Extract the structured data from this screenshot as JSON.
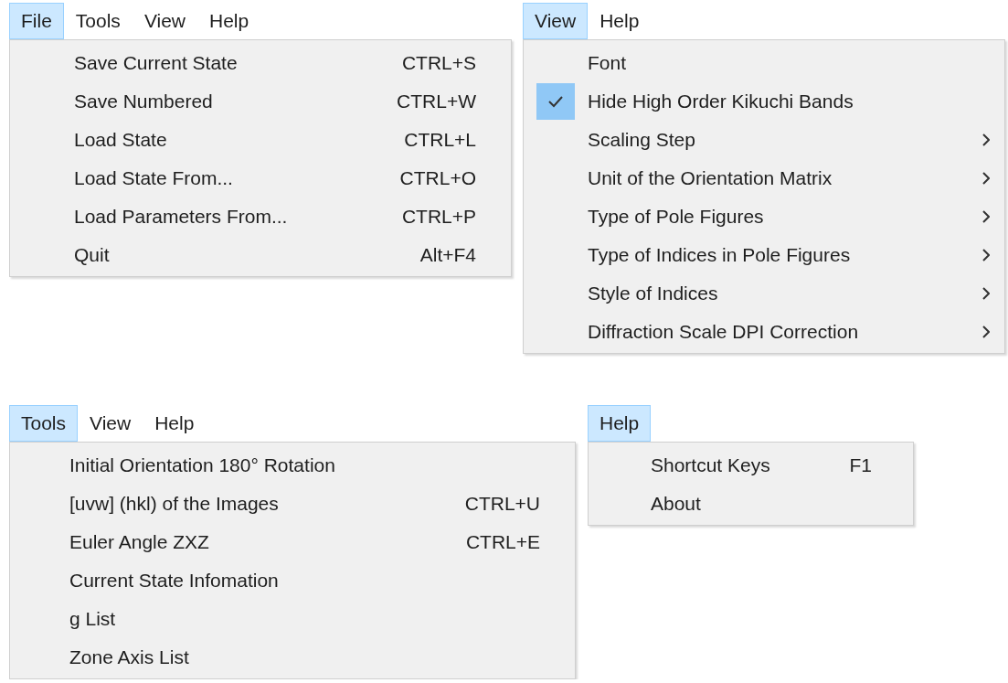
{
  "panels": [
    {
      "menubar": [
        {
          "label": "File",
          "selected": true
        },
        {
          "label": "Tools",
          "selected": false
        },
        {
          "label": "View",
          "selected": false
        },
        {
          "label": "Help",
          "selected": false
        }
      ],
      "items": [
        {
          "label": "Save Current State",
          "shortcut": "CTRL+S"
        },
        {
          "label": "Save Numbered",
          "shortcut": "CTRL+W"
        },
        {
          "label": "Load State",
          "shortcut": "CTRL+L"
        },
        {
          "label": "Load State From...",
          "shortcut": "CTRL+O"
        },
        {
          "label": "Load Parameters From...",
          "shortcut": "CTRL+P"
        },
        {
          "label": "Quit",
          "shortcut": "Alt+F4"
        }
      ]
    },
    {
      "menubar": [
        {
          "label": "View",
          "selected": true
        },
        {
          "label": "Help",
          "selected": false
        }
      ],
      "items": [
        {
          "label": "Font",
          "checked": false,
          "submenu": false
        },
        {
          "label": "Hide High Order Kikuchi Bands",
          "checked": true,
          "submenu": false
        },
        {
          "label": "Scaling Step",
          "checked": false,
          "submenu": true
        },
        {
          "label": "Unit of the Orientation Matrix",
          "checked": false,
          "submenu": true
        },
        {
          "label": "Type of Pole Figures",
          "checked": false,
          "submenu": true
        },
        {
          "label": "Type of Indices in Pole Figures",
          "checked": false,
          "submenu": true
        },
        {
          "label": "Style of Indices",
          "checked": false,
          "submenu": true
        },
        {
          "label": "Diffraction Scale DPI Correction",
          "checked": false,
          "submenu": true
        }
      ]
    },
    {
      "menubar": [
        {
          "label": "Tools",
          "selected": true
        },
        {
          "label": "View",
          "selected": false
        },
        {
          "label": "Help",
          "selected": false
        }
      ],
      "items": [
        {
          "label": "Initial Orientation 180° Rotation"
        },
        {
          "label": "[uvw] (hkl) of the Images",
          "shortcut": "CTRL+U"
        },
        {
          "label": "Euler Angle ZXZ",
          "shortcut": "CTRL+E"
        },
        {
          "label": "Current State Infomation"
        },
        {
          "label": "g List"
        },
        {
          "label": "Zone Axis List"
        }
      ]
    },
    {
      "menubar": [
        {
          "label": "Help",
          "selected": true
        }
      ],
      "items": [
        {
          "label": "Shortcut Keys",
          "shortcut": "F1"
        },
        {
          "label": "About"
        }
      ]
    }
  ]
}
